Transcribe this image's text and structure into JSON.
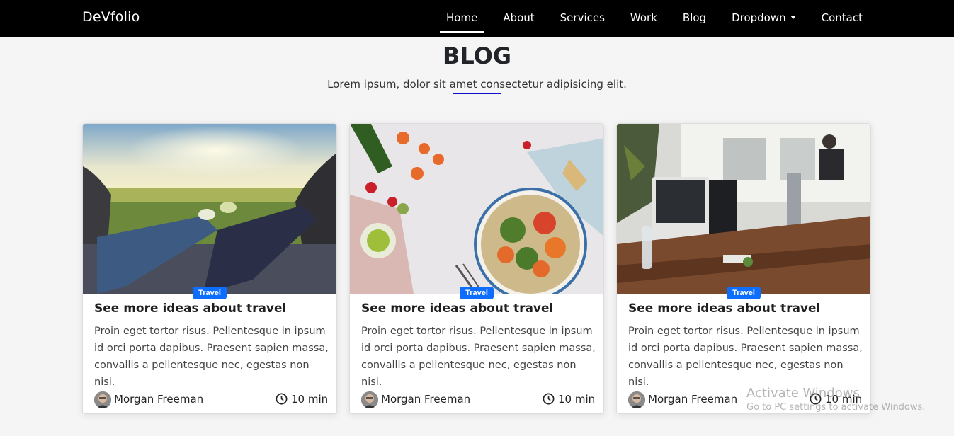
{
  "nav": {
    "brand": "DeVfolio",
    "links": [
      "Home",
      "About",
      "Services",
      "Work",
      "Blog",
      "Dropdown",
      "Contact"
    ]
  },
  "section": {
    "title": "BLOG",
    "subtitle": "Lorem ipsum, dolor sit amet consectetur adipisicing elit."
  },
  "cards": [
    {
      "badge": "Travel",
      "title": "See more ideas about travel",
      "text": "Proin eget tortor risus. Pellentesque in ipsum id orci porta dapibus. Praesent sapien massa, convallis a pellentesque nec, egestas non nisi.",
      "author": "Morgan Freeman",
      "time": "10 min",
      "image": "sunset-field-feet"
    },
    {
      "badge": "Travel",
      "title": "See more ideas about travel",
      "text": "Proin eget tortor risus. Pellentesque in ipsum id orci porta dapibus. Praesent sapien massa, convallis a pellentesque nec, egestas non nisi.",
      "author": "Morgan Freeman",
      "time": "10 min",
      "image": "vegetable-bowl"
    },
    {
      "badge": "Travel",
      "title": "See more ideas about travel",
      "text": "Proin eget tortor risus. Pellentesque in ipsum id orci porta dapibus. Praesent sapien massa, convallis a pellentesque nec, egestas non nisi.",
      "author": "Morgan Freeman",
      "time": "10 min",
      "image": "office-desk"
    }
  ],
  "watermark": {
    "line1": "Activate Windows",
    "line2": "Go to PC settings to activate Windows."
  },
  "colors": {
    "navbar": "#000000",
    "accent_line": "#0d0dcc",
    "badge": "#0d6efd",
    "background": "#f5f5f5"
  }
}
